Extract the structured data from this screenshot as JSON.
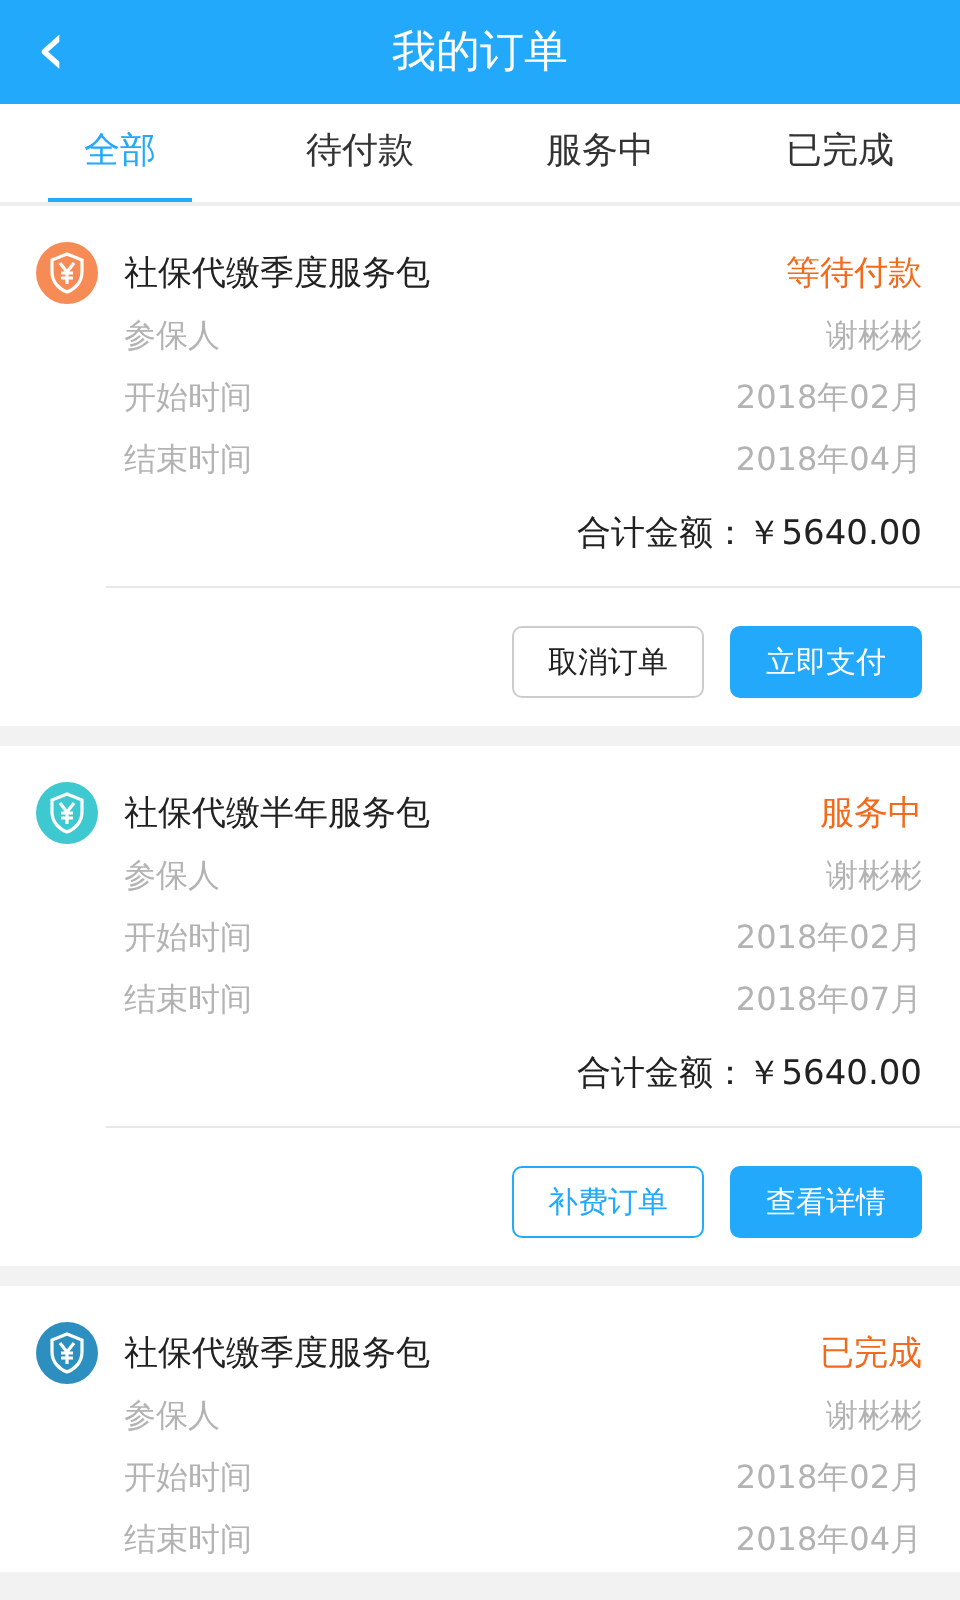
{
  "header": {
    "back_icon": "‹",
    "title": "我的订单"
  },
  "tabs": [
    {
      "label": "全部",
      "selected": true
    },
    {
      "label": "待付款",
      "selected": false
    },
    {
      "label": "服务中",
      "selected": false
    },
    {
      "label": "已完成",
      "selected": false
    }
  ],
  "orders": [
    {
      "color": "#f78b55",
      "name": "社保代缴季度服务包",
      "status": "等待付款",
      "fields": [
        {
          "label": "参保人",
          "value": "谢彬彬"
        },
        {
          "label": "开始时间",
          "value": "2018年02月"
        },
        {
          "label": "结束时间",
          "value": "2018年04月"
        }
      ],
      "total": "合计金额：￥5640.00",
      "buttons": [
        {
          "label": "取消订单",
          "kind": "plain"
        },
        {
          "label": "立即支付",
          "kind": "primary"
        }
      ]
    },
    {
      "color": "#3ec8cf",
      "name": "社保代缴半年服务包",
      "status": "服务中",
      "fields": [
        {
          "label": "参保人",
          "value": "谢彬彬"
        },
        {
          "label": "开始时间",
          "value": "2018年02月"
        },
        {
          "label": "结束时间",
          "value": "2018年07月"
        }
      ],
      "total": "合计金额：￥5640.00",
      "buttons": [
        {
          "label": "补费订单",
          "kind": "outline"
        },
        {
          "label": "查看详情",
          "kind": "primary"
        }
      ]
    },
    {
      "color": "#2d8fbf",
      "name": "社保代缴季度服务包",
      "status": "已完成",
      "fields": [
        {
          "label": "参保人",
          "value": "谢彬彬"
        },
        {
          "label": "开始时间",
          "value": "2018年02月"
        },
        {
          "label": "结束时间",
          "value": "2018年04月"
        }
      ]
    }
  ]
}
